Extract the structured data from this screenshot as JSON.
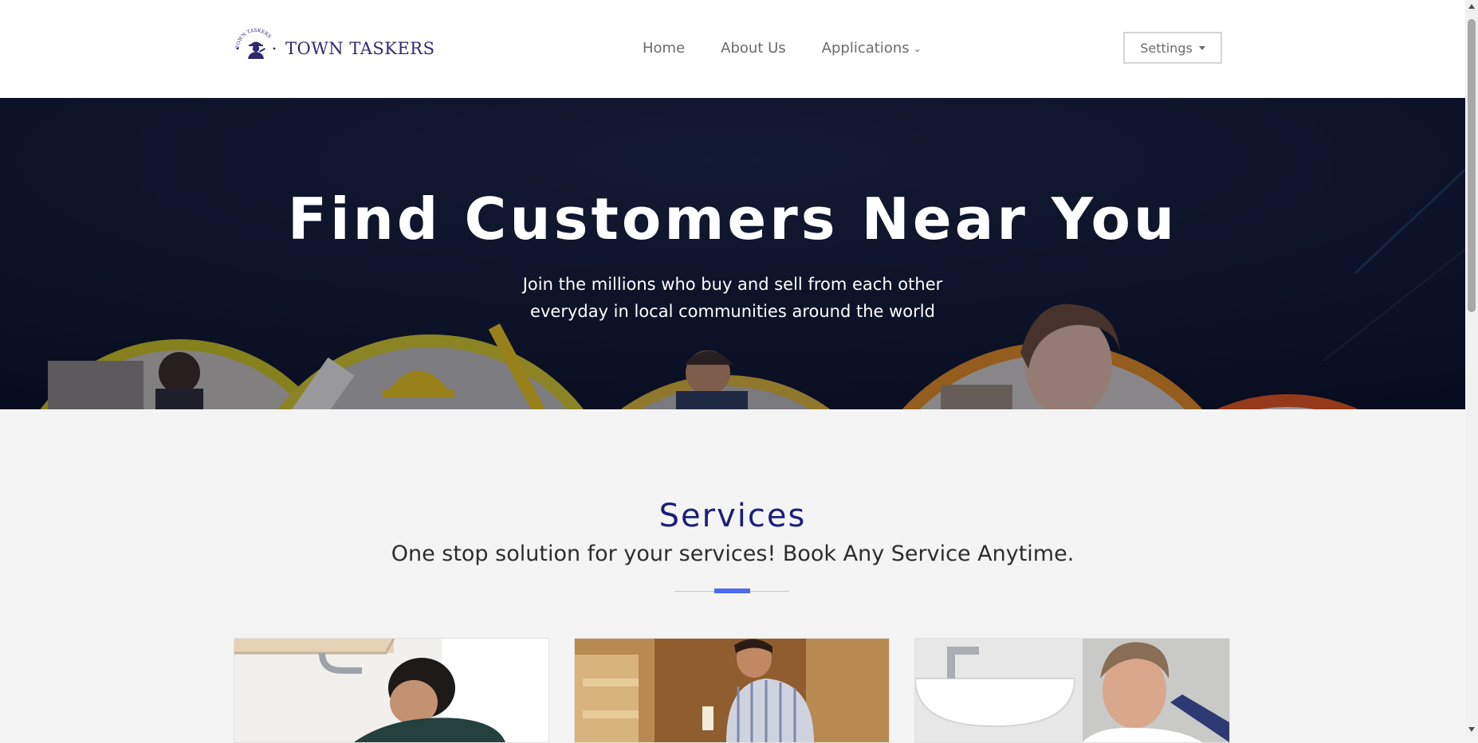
{
  "brand": {
    "name": "TOWN TASKERS",
    "badge_text": "TOWN TASKERS",
    "color": "#2e2a72"
  },
  "nav": {
    "items": [
      {
        "label": "Home"
      },
      {
        "label": "About Us"
      },
      {
        "label": "Applications",
        "has_dropdown": true
      }
    ]
  },
  "settings": {
    "label": "Settings"
  },
  "hero": {
    "title": "Find Customers Near You",
    "subtitle_line1": "Join the millions who buy and sell from each other",
    "subtitle_line2": "everyday in local communities around the world"
  },
  "services": {
    "title": "Services",
    "subtitle": "One stop solution for your services! Book Any Service Anytime.",
    "accent_color": "#4b6bf0",
    "title_color": "#1c1e7a",
    "cards": [
      {
        "image": "plumber-under-sink-photo"
      },
      {
        "image": "carpenter-woodwork-photo"
      },
      {
        "image": "plumber-at-washbasin-photo"
      }
    ]
  }
}
